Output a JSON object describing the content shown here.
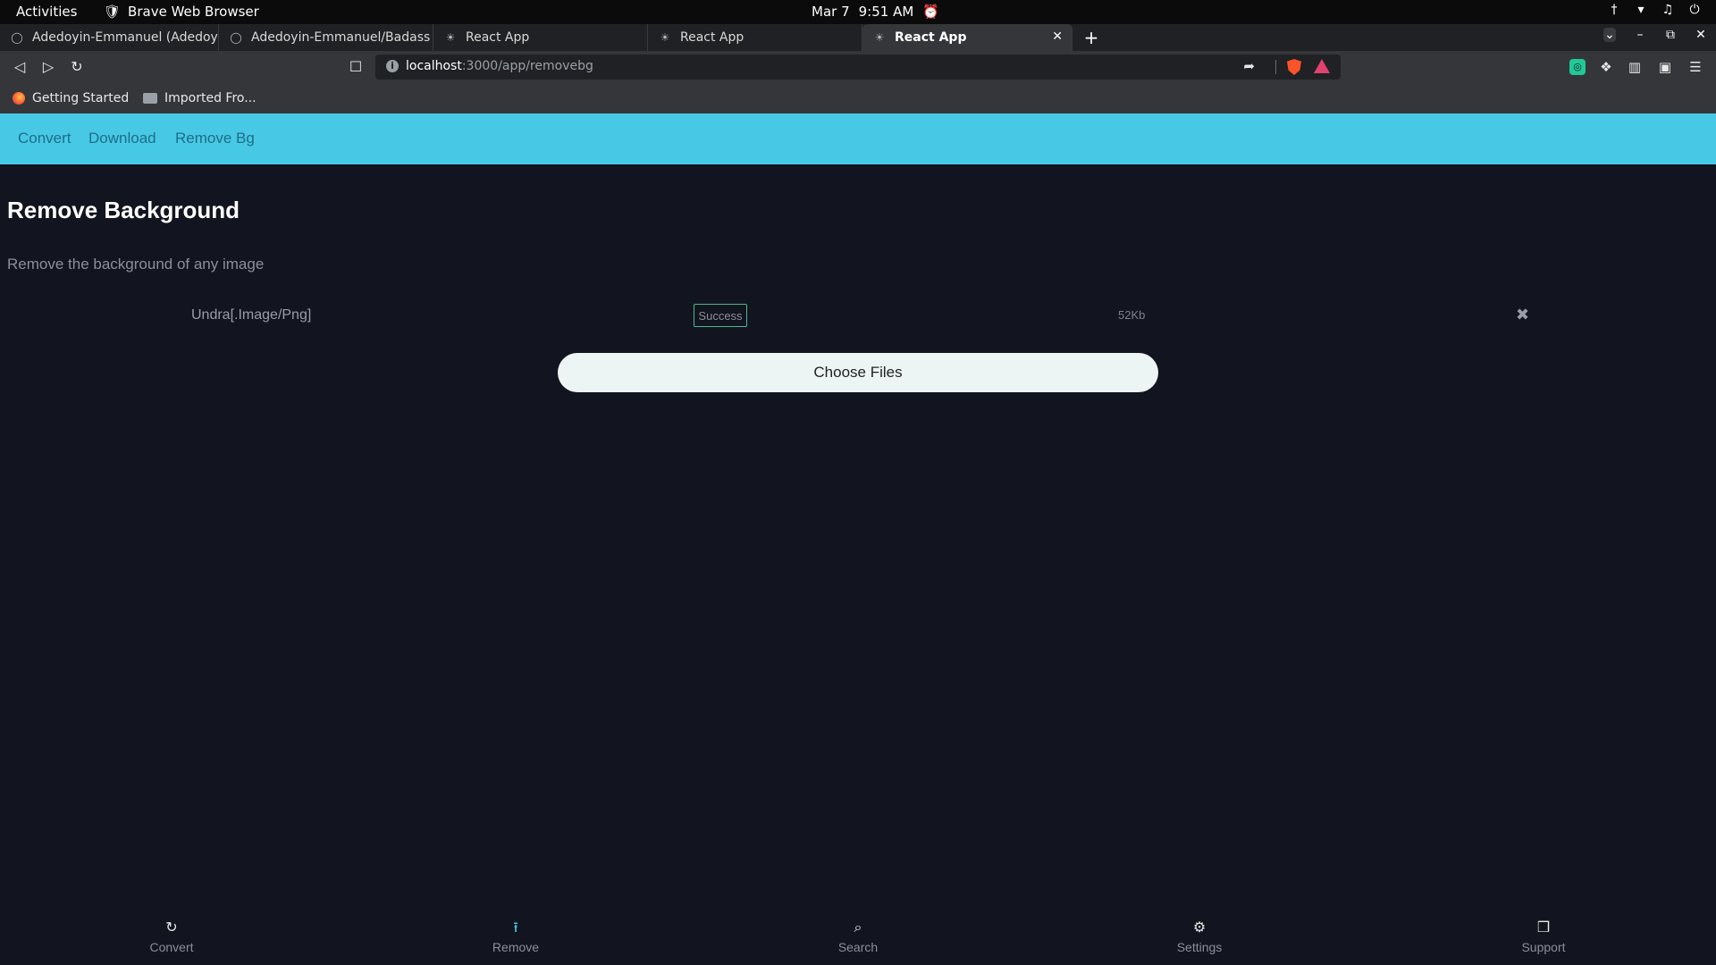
{
  "system": {
    "activities": "Activities",
    "app_name": "Brave Web Browser",
    "date": "Mar 7",
    "time": "9:51 AM"
  },
  "tabs": [
    {
      "label": "Adedoyin-Emmanuel (Adedoy",
      "active": false
    },
    {
      "label": "Adedoyin-Emmanuel/Badass",
      "active": false
    },
    {
      "label": "React App",
      "active": false
    },
    {
      "label": "React App",
      "active": false
    },
    {
      "label": "React App",
      "active": true
    }
  ],
  "toolbar": {
    "url_host": "localhost",
    "url_path": ":3000/app/removebg"
  },
  "bookmarks": [
    {
      "label": "Getting Started"
    },
    {
      "label": "Imported Fro..."
    }
  ],
  "appnav": {
    "items": [
      "Convert",
      "Download",
      "Remove Bg"
    ]
  },
  "main": {
    "title": "Remove Background",
    "subtitle": "Remove the background of any image",
    "file": {
      "name": "Undra[.Image/Png]",
      "status": "Success",
      "size": "52Kb"
    },
    "choose_label": "Choose Files"
  },
  "bottom_nav": [
    {
      "label": "Convert",
      "icon": "refresh-icon"
    },
    {
      "label": "Remove",
      "icon": "upload-icon",
      "active": true
    },
    {
      "label": "Search",
      "icon": "search-icon"
    },
    {
      "label": "Settings",
      "icon": "gear-icon"
    },
    {
      "label": "Support",
      "icon": "gift-icon"
    }
  ],
  "colors": {
    "app_nav_bg": "#47c9e5",
    "page_bg": "#12141f",
    "success_border": "#4bb98f"
  }
}
